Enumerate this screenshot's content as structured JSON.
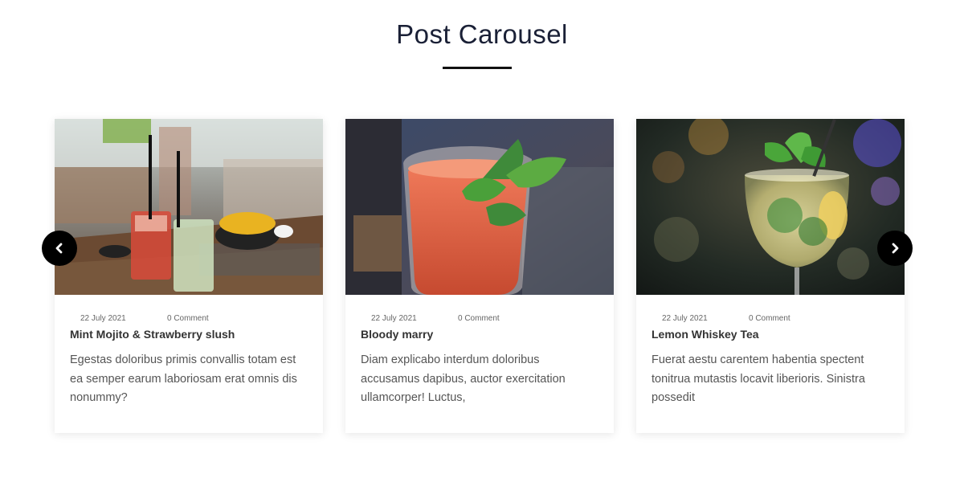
{
  "section": {
    "title": "Post Carousel"
  },
  "posts": [
    {
      "date": "22 July 2021",
      "comments": "0 Comment",
      "title": "Mint Mojito & Strawberry slush",
      "excerpt": "Egestas doloribus primis convallis totam est ea semper earum laboriosam erat omnis dis nonummy?"
    },
    {
      "date": "22 July 2021",
      "comments": "0 Comment",
      "title": "Bloody marry",
      "excerpt": "Diam explicabo interdum doloribus accusamus dapibus, auctor exercitation ullamcorper! Luctus,"
    },
    {
      "date": "22 July 2021",
      "comments": "0 Comment",
      "title": "Lemon Whiskey Tea",
      "excerpt": "Fuerat aestu carentem habentia spectent tonitrua mutastis locavit liberioris. Sinistra possedit"
    }
  ],
  "controls": {
    "prev_icon": "chevron-left-icon",
    "next_icon": "chevron-right-icon"
  },
  "colors": {
    "title": "#1a2036",
    "arrow_bg": "#000000",
    "rule": "#111111"
  }
}
